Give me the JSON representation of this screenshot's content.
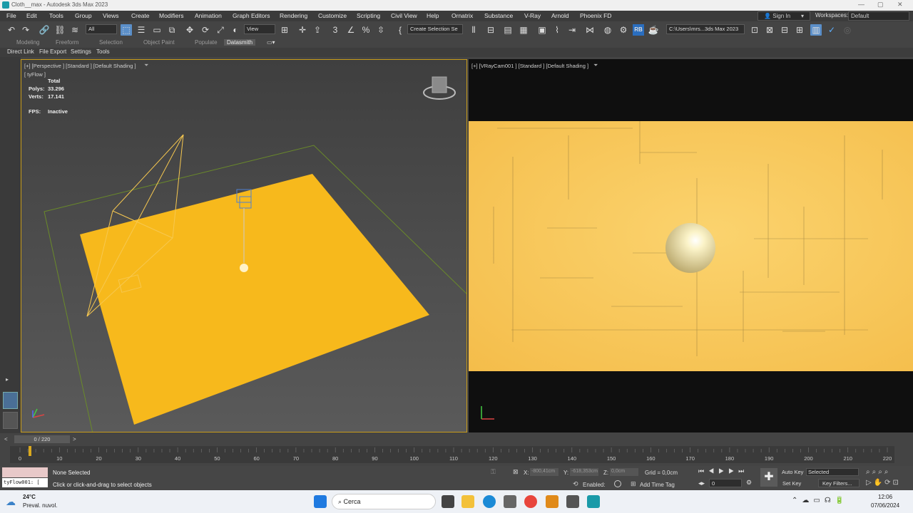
{
  "window": {
    "title": "Cloth__max - Autodesk 3ds Max 2023",
    "minimize": "—",
    "maximize": "▢",
    "close": "✕"
  },
  "menu": [
    "File",
    "Edit",
    "Tools",
    "Group",
    "Views",
    "Create",
    "Modifiers",
    "Animation",
    "Graph Editors",
    "Rendering",
    "Customize",
    "Scripting",
    "Civil View",
    "Help",
    "Ornatrix",
    "Substance",
    "V-Ray",
    "Arnold",
    "Phoenix FD"
  ],
  "account": {
    "signin": "Sign In",
    "workspaces_label": "Workspaces:",
    "workspace": "Default"
  },
  "toolbar": {
    "filter": "All",
    "coord": "View",
    "selection_set": "Create Selection Se",
    "path": "C:\\Users\\mrs...3ds Max 2023",
    "rb_label": "RB"
  },
  "tabs": [
    {
      "label": "Modeling"
    },
    {
      "label": "Freeform"
    },
    {
      "label": "Selection"
    },
    {
      "label": "Object Paint"
    },
    {
      "label": "Populate"
    },
    {
      "label": "Datasmith"
    }
  ],
  "subtabs": [
    "Direct Link",
    "File Export",
    "Settings",
    "Tools"
  ],
  "viewport_left": {
    "label": "[+] [Perspective ] [Standard ] [Default Shading ]",
    "sublabel": "[ tyFlow ]",
    "stats_header": "Total",
    "polys_label": "Polys:",
    "polys": "33.296",
    "verts_label": "Verts:",
    "verts": "17.141",
    "fps_label": "FPS:",
    "fps": "Inactive"
  },
  "viewport_right": {
    "label": "[+] [VRayCam001 ] [Standard ] [Default Shading ]"
  },
  "timeline": {
    "frame": "0 / 220",
    "ticks": [
      "0",
      "10",
      "20",
      "30",
      "40",
      "50",
      "60",
      "70",
      "80",
      "90",
      "100",
      "110",
      "120",
      "130",
      "140",
      "150",
      "160",
      "170",
      "180",
      "190",
      "200",
      "210",
      "220"
    ]
  },
  "status": {
    "selection": "None Selected",
    "prompt": "Click or click-and-drag to select objects",
    "script_field": "tyFlow001: [",
    "x_label": "X:",
    "x": "-800,41cm",
    "y_label": "Y:",
    "y": "-618,353cm",
    "z_label": "Z:",
    "z": "0,0cm",
    "grid": "Grid = 0,0cm",
    "enabled": "Enabled:",
    "add_time_tag": "Add Time Tag",
    "auto_key": "Auto Key",
    "set_key": "Set Key",
    "selected": "Selected",
    "key_filters": "Key Filters...",
    "frame_value": "0"
  },
  "taskbar": {
    "temp": "24°C",
    "weather": "Preval. nuvol.",
    "search": "Cerca",
    "time": "12:06",
    "date": "07/06/2024"
  },
  "colors": {
    "cloth": "#f7b91c",
    "accent": "#5b8fc9",
    "viewport_border": "#c89c19"
  }
}
